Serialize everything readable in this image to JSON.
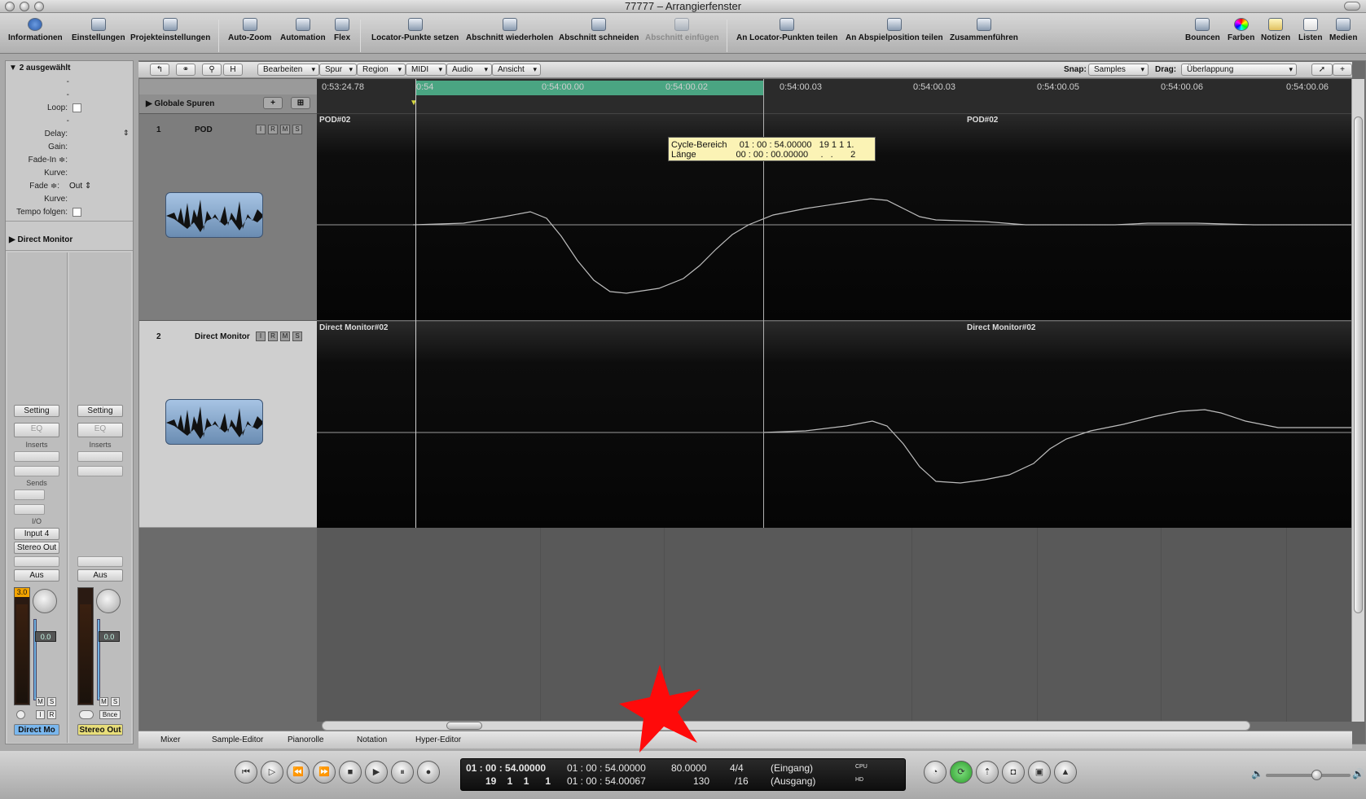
{
  "window": {
    "title": "77777 – Arrangierfenster"
  },
  "toolbar": {
    "items": [
      "Informationen",
      "Einstellungen",
      "Projekteinstellungen",
      "Auto-Zoom",
      "Automation",
      "Flex",
      "Locator-Punkte setzen",
      "Abschnitt wiederholen",
      "Abschnitt schneiden",
      "Abschnitt einfügen",
      "An Locator-Punkten teilen",
      "An Abspielposition teilen",
      "Zusammenführen"
    ],
    "right_items": [
      "Bouncen",
      "Farben",
      "Notizen",
      "Listen",
      "Medien"
    ]
  },
  "inspector": {
    "header": "2 ausgewählt",
    "dash": "-",
    "loop": "Loop:",
    "delay": "Delay:",
    "gain": "Gain:",
    "fade_in": "Fade-In ≑:",
    "kurve": "Kurve:",
    "fade": "Fade ≑:",
    "fade_out": "Out",
    "tempo": "Tempo folgen:",
    "direct_monitor": "Direct Monitor",
    "setting": "Setting",
    "eq": "EQ",
    "inserts": "Inserts",
    "sends": "Sends",
    "io": "I/O",
    "input": "Input 4",
    "stereo_out": "Stereo Out",
    "aus": "Aus",
    "meter1": "3.0",
    "fader_val": "0.0",
    "m": "M",
    "s": "S",
    "i": "I",
    "r": "R",
    "bnce": "Bnce",
    "ch1_name": "Direct Mo",
    "ch2_name": "Stereo Out"
  },
  "localmenu": {
    "items": [
      "Bearbeiten",
      "Spur",
      "Region",
      "MIDI",
      "Audio",
      "Ansicht"
    ],
    "snap_label": "Snap:",
    "snap_value": "Samples",
    "drag_label": "Drag:",
    "drag_value": "Überlappung",
    "h": "H"
  },
  "ruler": {
    "ticks": [
      "0:53:24.78",
      "0:54",
      "0:54:00.00",
      "0:54:00.02",
      "0:54:00.03",
      "0:54:00.03",
      "0:54:00.05",
      "0:54:00.06",
      "0:54:00.06"
    ]
  },
  "global_tracks": "Globale Spuren",
  "tracks": [
    {
      "num": "1",
      "name": "POD",
      "region": "POD#02"
    },
    {
      "num": "2",
      "name": "Direct Monitor",
      "region": "Direct Monitor#02"
    }
  ],
  "track_btns": [
    "I",
    "R",
    "M",
    "S"
  ],
  "tooltip": {
    "line1": "Cycle-Bereich     01 : 00 : 54.00000   19 1 1 1.",
    "line2": "Länge                00 : 00 : 00.00000     .   .       2"
  },
  "tabs": [
    "Mixer",
    "Sample-Editor",
    "Pianorolle",
    "Notation",
    "Hyper-Editor"
  ],
  "transport": {
    "smpte": "01 : 00 : 54.00000",
    "bars": "19    1    1      1",
    "cycle_start": "01 : 00 : 54.00000",
    "cycle_end": "01 : 00 : 54.00067",
    "tempo": "80.0000",
    "tempo2": "130",
    "sig": "4/4",
    "div": "/16",
    "in": "(Eingang)",
    "out": "(Ausgang)",
    "cpu": "CPU",
    "hd": "HD"
  }
}
